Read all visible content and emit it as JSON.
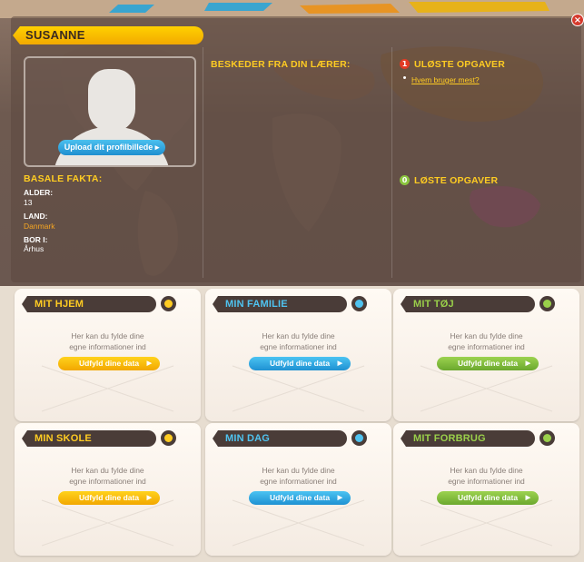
{
  "profile": {
    "name": "SUSANNE",
    "close_icon": "close-icon",
    "upload_label": "Upload dit profilbillede",
    "basic_facts_title": "BASALE FAKTA:",
    "facts": [
      {
        "label": "ALDER:",
        "value": "13"
      },
      {
        "label": "LAND:",
        "value": "Danmark"
      },
      {
        "label": "BOR I:",
        "value": "Århus"
      }
    ]
  },
  "messages": {
    "title": "BESKEDER FRA DIN LÆRER:"
  },
  "tasks": {
    "unsolved_title": "ULØSTE OPGAVER",
    "unsolved_count": "1",
    "unsolved_items": [
      "Hvem bruger mest?"
    ],
    "solved_title": "LØSTE OPGAVER",
    "solved_count": "0"
  },
  "cards": [
    {
      "title": "MIT HJEM",
      "color": "yellow",
      "line1": "Her kan du fylde dine",
      "line2": "egne informationer ind",
      "button": "Udfyld dine data"
    },
    {
      "title": "MIN FAMILIE",
      "color": "blue",
      "line1": "Her kan du fylde dine",
      "line2": "egne informationer ind",
      "button": "Udfyld dine data"
    },
    {
      "title": "MIT TØJ",
      "color": "green",
      "line1": "Her kan du fylde dine",
      "line2": "egne informationer ind",
      "button": "Udfyld dine data"
    },
    {
      "title": "MIN SKOLE",
      "color": "yellow",
      "line1": "Her kan du fylde dine",
      "line2": "egne informationer ind",
      "button": "Udfyld dine data"
    },
    {
      "title": "MIN DAG",
      "color": "blue",
      "line1": "Her kan du fylde dine",
      "line2": "egne informationer ind",
      "button": "Udfyld dine data"
    },
    {
      "title": "MIT FORBRUG",
      "color": "green",
      "line1": "Her kan du fylde dine",
      "line2": "egne informationer ind",
      "button": "Udfyld dine data"
    }
  ],
  "colors": {
    "yellow": "#ffcc22",
    "blue": "#4fc3f0",
    "green": "#9ad04a",
    "panel": "#5c4840"
  }
}
